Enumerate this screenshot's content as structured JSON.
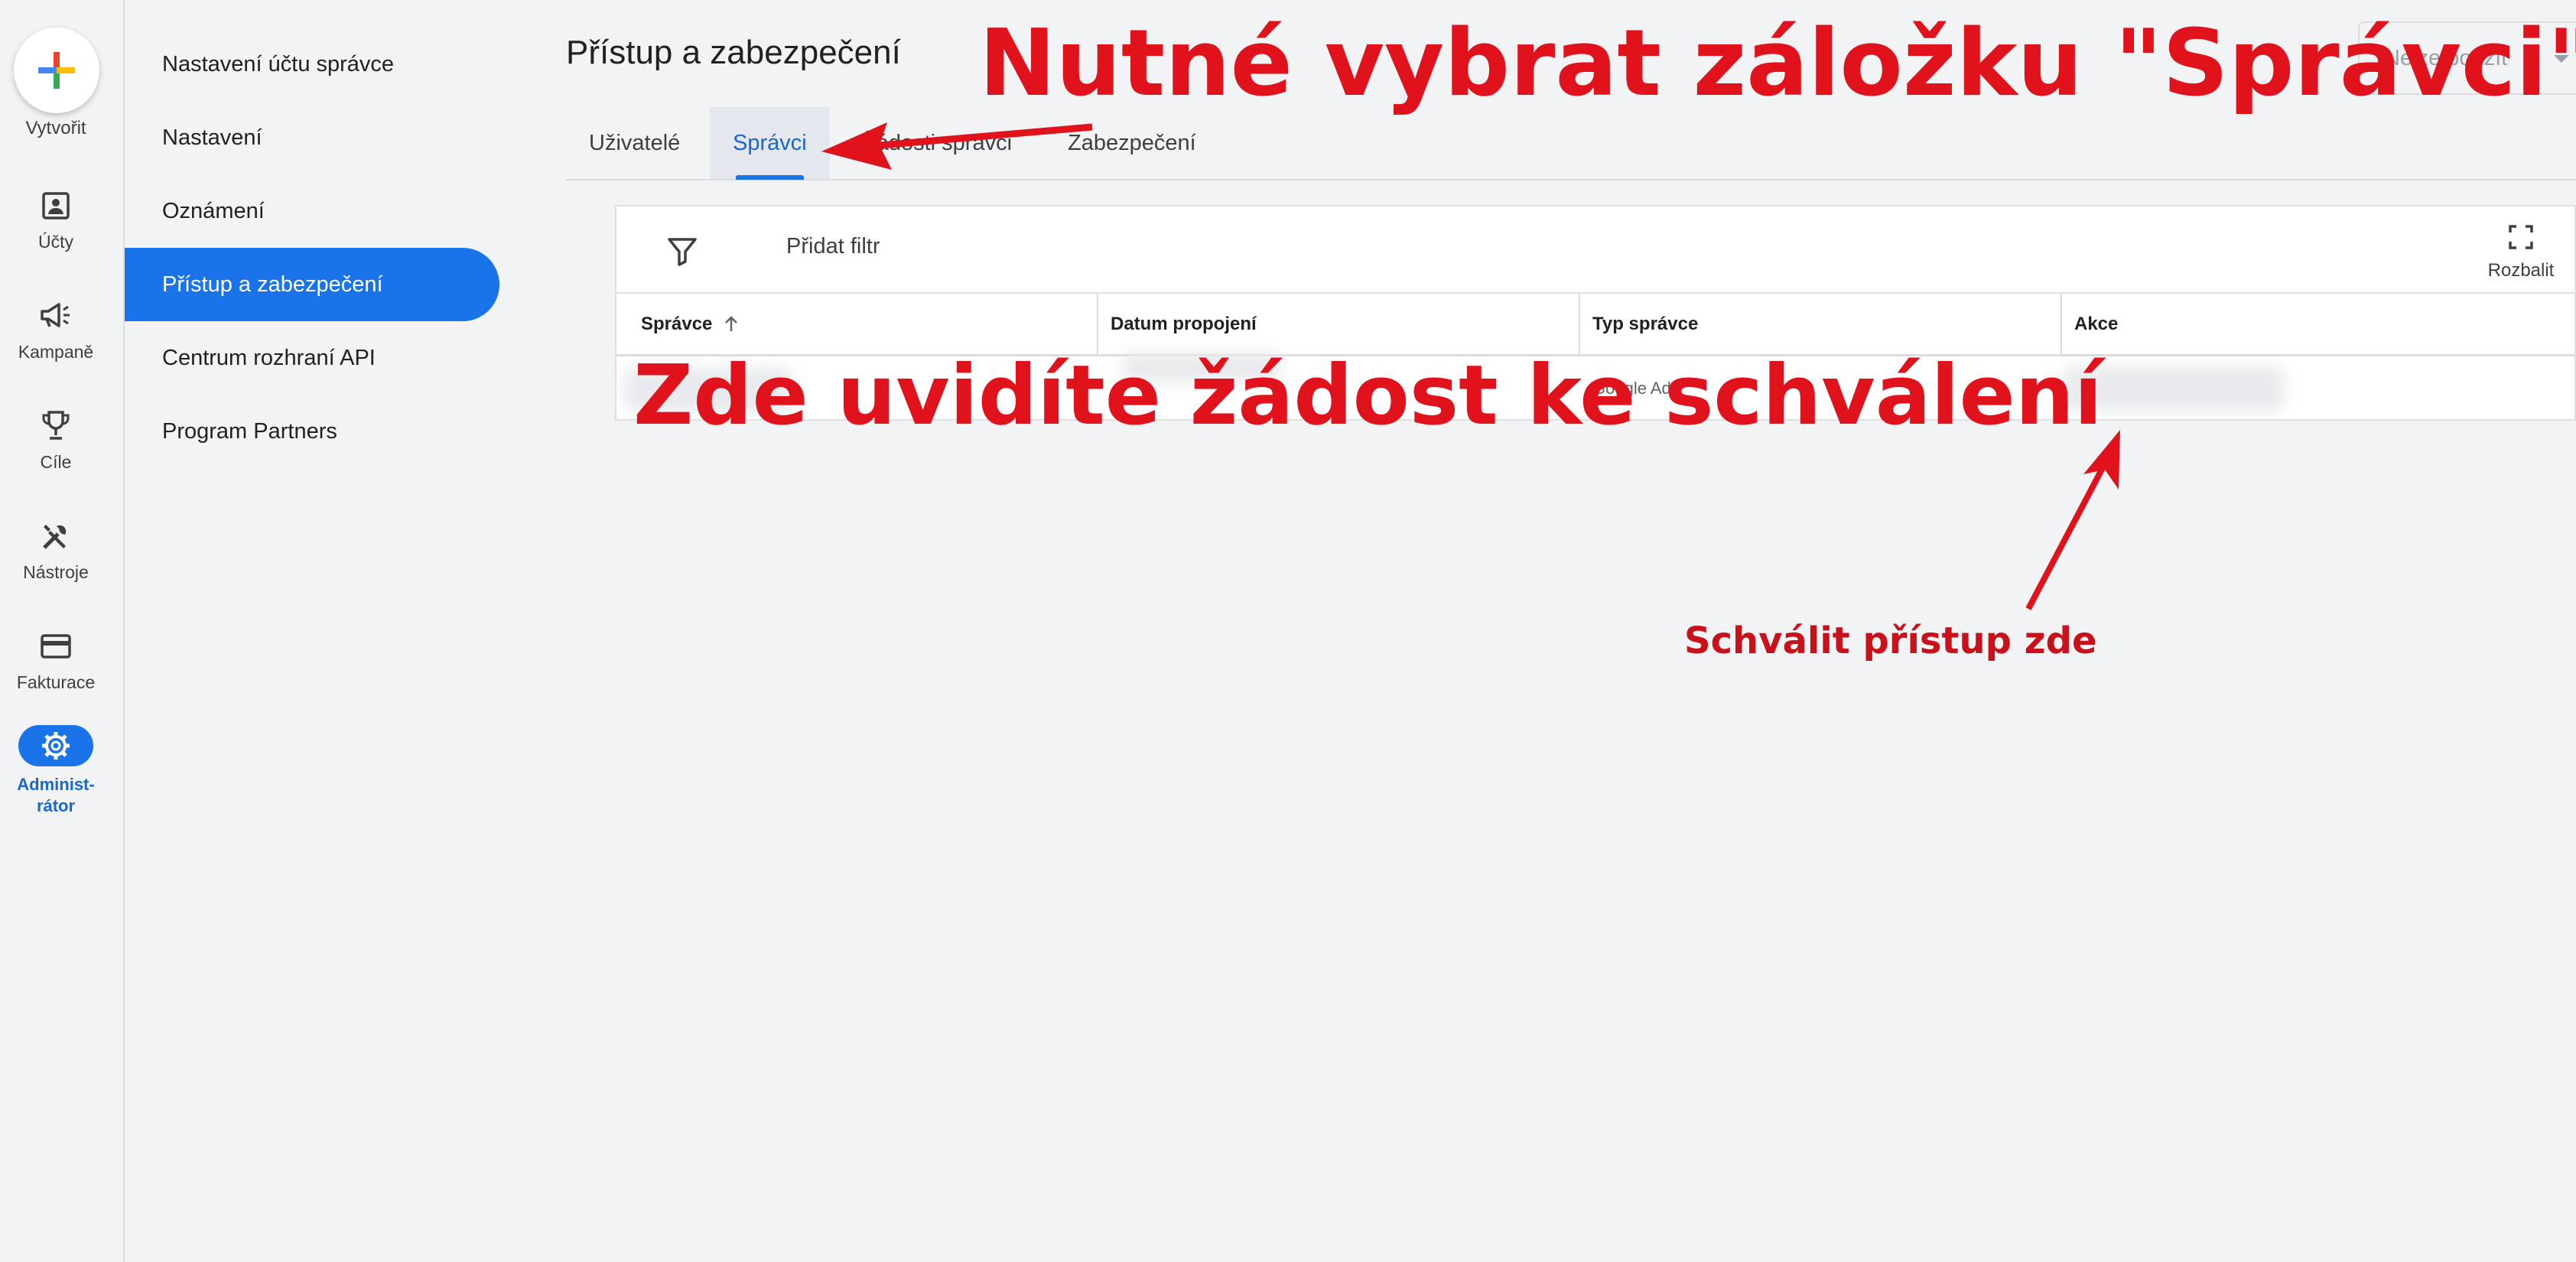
{
  "rail": {
    "create_label": "Vytvořit",
    "items": [
      {
        "label": "Účty",
        "icon": "accounts-icon"
      },
      {
        "label": "Kampaně",
        "icon": "campaigns-icon"
      },
      {
        "label": "Cíle",
        "icon": "goals-icon"
      },
      {
        "label": "Nástroje",
        "icon": "tools-icon"
      },
      {
        "label": "Fakturace",
        "icon": "billing-icon"
      },
      {
        "label_line1": "Administ-",
        "label_line2": "rátor",
        "icon": "gear-icon",
        "active": true
      }
    ]
  },
  "nav": {
    "items": [
      {
        "label": "Nastavení účtu správce"
      },
      {
        "label": "Nastavení"
      },
      {
        "label": "Oznámení"
      },
      {
        "label": "Přístup a zabezpečení",
        "active": true
      },
      {
        "label": "Centrum rozhraní API"
      },
      {
        "label": "Program Partners"
      }
    ]
  },
  "main": {
    "title": "Přístup a zabezpečení",
    "unusable_label": "Nelze použít",
    "tabs": [
      {
        "label": "Uživatelé"
      },
      {
        "label": "Správci",
        "active": true
      },
      {
        "label": "Žádosti správci"
      },
      {
        "label": "Zabezpečení"
      }
    ],
    "filter_label": "Přidat filtr",
    "expand_label": "Rozbalit",
    "table": {
      "columns": [
        "Správce",
        "Datum propojení",
        "Typ správce",
        "Akce"
      ],
      "rows": [
        {
          "manager_type": "Google Ads"
        }
      ]
    }
  },
  "annotations": {
    "select_tab": "Nutné vybrat záložku \"Správci\"",
    "request_here": "Zde uvidíte žádost ke schválení",
    "approve_here": "Schválit přístup zde"
  },
  "colors": {
    "accent": "#1a73e8",
    "annotation": "#e0121b"
  }
}
